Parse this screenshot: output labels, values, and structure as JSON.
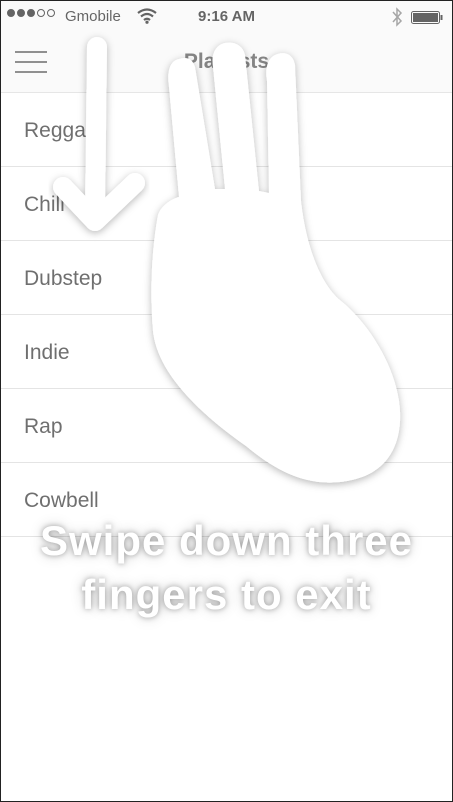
{
  "status_bar": {
    "carrier": "Gmobile",
    "time": "9:16 AM",
    "signal_bars": 3,
    "signal_total": 5
  },
  "nav": {
    "title": "Playlists",
    "menu_icon": "hamburger-menu-icon"
  },
  "playlists": [
    "Reggae",
    "Chill",
    "Dubstep",
    "Indie",
    "Rap",
    "Cowbell"
  ],
  "overlay": {
    "line1": "Swipe down three",
    "line2": "fingers to exit",
    "hand_icon": "three-finger-hand-icon",
    "arrow_icon": "down-arrow-icon"
  }
}
